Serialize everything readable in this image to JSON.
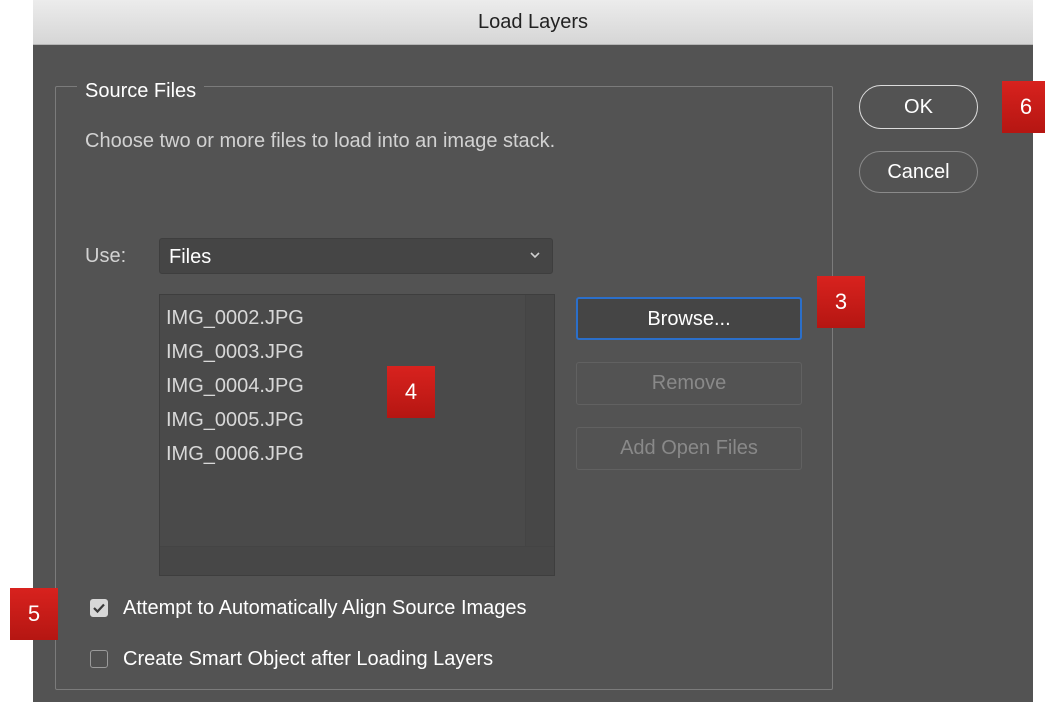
{
  "window": {
    "title": "Load Layers"
  },
  "source_files": {
    "legend": "Source Files",
    "description": "Choose two or more files to load into an image stack.",
    "use_label": "Use:",
    "use_value": "Files",
    "files": [
      "IMG_0002.JPG",
      "IMG_0003.JPG",
      "IMG_0004.JPG",
      "IMG_0005.JPG",
      "IMG_0006.JPG"
    ]
  },
  "buttons": {
    "ok": "OK",
    "cancel": "Cancel",
    "browse": "Browse...",
    "remove": "Remove",
    "add_open_files": "Add Open Files"
  },
  "options": {
    "auto_align": {
      "label": "Attempt to Automatically Align Source Images",
      "checked": true
    },
    "smart_object": {
      "label": "Create Smart Object after Loading Layers",
      "checked": false
    }
  },
  "badges": [
    "3",
    "4",
    "5",
    "6"
  ],
  "colors": {
    "dialog_bg": "#535353",
    "focus_ring": "#2b6fca",
    "badge_red": "#c81a16"
  }
}
